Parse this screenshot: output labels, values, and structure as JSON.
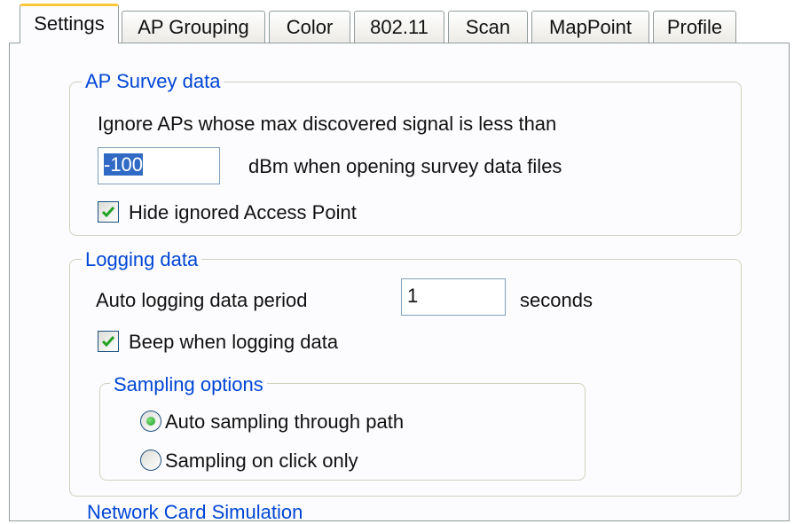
{
  "tabs": [
    {
      "label": "Settings",
      "active": true
    },
    {
      "label": "AP Grouping",
      "active": false
    },
    {
      "label": "Color",
      "active": false
    },
    {
      "label": "802.11",
      "active": false
    },
    {
      "label": "Scan",
      "active": false
    },
    {
      "label": "MapPoint",
      "active": false
    },
    {
      "label": "Profile",
      "active": false
    }
  ],
  "ap_survey": {
    "title": "AP Survey data",
    "ignore_text": "Ignore APs whose max discovered signal is less than",
    "threshold_value": "-100",
    "threshold_suffix": "dBm when opening survey data files",
    "hide_ignored_label": "Hide ignored Access Point",
    "hide_ignored_checked": true
  },
  "logging": {
    "title": "Logging data",
    "period_label": "Auto logging data period",
    "period_value": "1",
    "period_unit": "seconds",
    "beep_label": "Beep when logging data",
    "beep_checked": true,
    "sampling": {
      "title": "Sampling options",
      "options": [
        {
          "label": "Auto sampling through path",
          "selected": true
        },
        {
          "label": "Sampling on click only",
          "selected": false
        }
      ]
    }
  },
  "partial_next_group_title": "Network Card Simulation",
  "colors": {
    "legend": "#0046d5",
    "active_tab_highlight": "#ffc83c",
    "selection": "#316ac5",
    "check": "#21a121"
  }
}
